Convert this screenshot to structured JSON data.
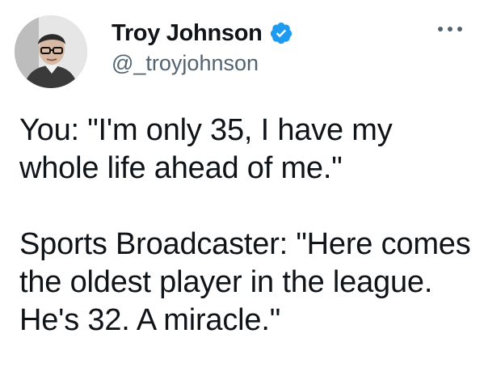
{
  "tweet": {
    "author": {
      "display_name": "Troy Johnson",
      "handle": "@_troyjohnson",
      "verified": true,
      "avatar_icon": "profile-photo"
    },
    "more_icon": "more-horizontal-icon",
    "paragraphs": [
      "You: \"I'm only 35, I have my whole life ahead of me.\"",
      "Sports Broadcaster: \"Here comes the oldest player in the league. He's 32. A miracle.\""
    ]
  },
  "colors": {
    "text": "#0f1419",
    "secondary_text": "#536471",
    "verified_blue": "#1d9bf0",
    "background": "#ffffff"
  }
}
